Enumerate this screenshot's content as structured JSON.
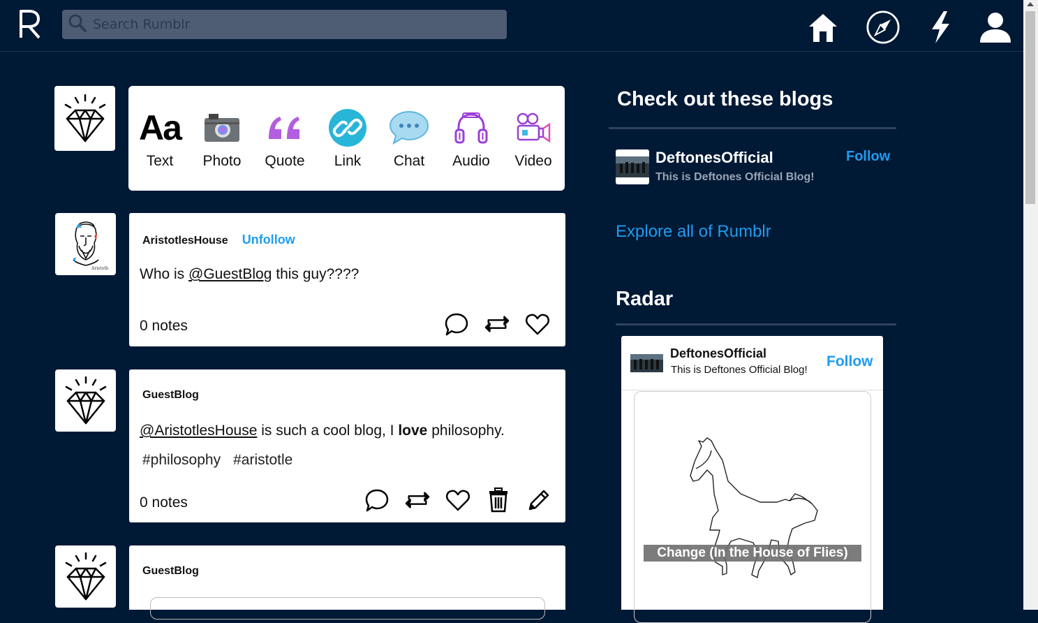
{
  "app": {
    "logo_letter": "R"
  },
  "search": {
    "placeholder": "Search Rumblr"
  },
  "nav": [
    "home-icon",
    "explore-compass-icon",
    "activity-bolt-icon",
    "account-user-icon"
  ],
  "composer": {
    "types": [
      {
        "label": "Text",
        "icon": "text-aa-icon"
      },
      {
        "label": "Photo",
        "icon": "camera-icon"
      },
      {
        "label": "Quote",
        "icon": "quote-icon"
      },
      {
        "label": "Link",
        "icon": "link-icon"
      },
      {
        "label": "Chat",
        "icon": "chat-bubble-icon"
      },
      {
        "label": "Audio",
        "icon": "headphones-icon"
      },
      {
        "label": "Video",
        "icon": "video-camera-icon"
      }
    ]
  },
  "posts": [
    {
      "user": "AristotlesHouse",
      "follow_label": "Unfollow",
      "body": {
        "pre": "Who is ",
        "mention": "@GuestBlog",
        "post": " this guy????"
      },
      "notes": "0 notes"
    },
    {
      "user": "GuestBlog",
      "body": {
        "mention": "@AristotlesHouse",
        "mid": " is such a cool blog, I ",
        "bold": "love",
        "post": " philosophy."
      },
      "tags": [
        "#philosophy",
        "#aristotle"
      ],
      "notes": "0 notes"
    },
    {
      "user": "GuestBlog"
    }
  ],
  "sidebar": {
    "check_out_title": "Check out these blogs",
    "recommended": {
      "name": "DeftonesOfficial",
      "description": "This is Deftones Official Blog!",
      "follow_label": "Follow"
    },
    "explore_link": "Explore all of Rumblr",
    "radar_title": "Radar",
    "radar": {
      "name": "DeftonesOfficial",
      "description": "This is Deftones Official Blog!",
      "follow_label": "Follow",
      "caption": "Change (In the House of Flies)"
    }
  },
  "colors": {
    "background": "#001935",
    "accent": "#1e9cf0",
    "search_bg": "#4e5d73"
  }
}
